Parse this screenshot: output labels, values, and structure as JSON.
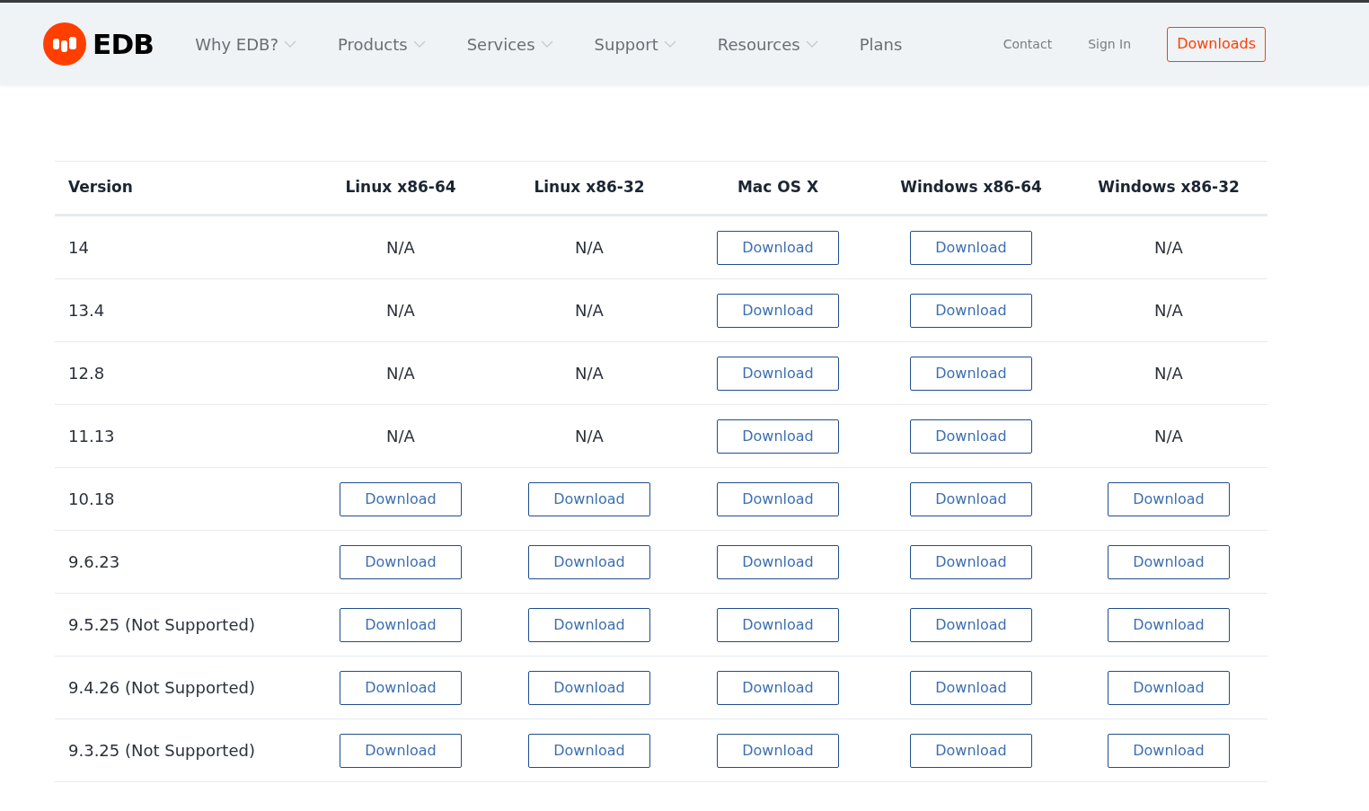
{
  "nav": {
    "brand": "EDB",
    "menu": [
      {
        "label": "Why EDB?",
        "dropdown": true
      },
      {
        "label": "Products",
        "dropdown": true
      },
      {
        "label": "Services",
        "dropdown": true
      },
      {
        "label": "Support",
        "dropdown": true
      },
      {
        "label": "Resources",
        "dropdown": true
      },
      {
        "label": "Plans",
        "dropdown": false
      }
    ],
    "links": [
      "Contact",
      "Sign In"
    ],
    "cta": "Downloads"
  },
  "table": {
    "columns": [
      "Version",
      "Linux x86-64",
      "Linux x86-32",
      "Mac OS X",
      "Windows x86-64",
      "Windows x86-32"
    ],
    "rows": [
      {
        "cells": [
          {
            "kind": "version",
            "text": "14"
          },
          {
            "kind": "text",
            "text": "N/A"
          },
          {
            "kind": "text",
            "text": "N/A"
          },
          {
            "kind": "button",
            "text": "Download"
          },
          {
            "kind": "button",
            "text": "Download"
          },
          {
            "kind": "text",
            "text": "N/A"
          }
        ]
      },
      {
        "cells": [
          {
            "kind": "version",
            "text": "13.4"
          },
          {
            "kind": "text",
            "text": "N/A"
          },
          {
            "kind": "text",
            "text": "N/A"
          },
          {
            "kind": "button",
            "text": "Download"
          },
          {
            "kind": "button",
            "text": "Download"
          },
          {
            "kind": "text",
            "text": "N/A"
          }
        ]
      },
      {
        "cells": [
          {
            "kind": "version",
            "text": "12.8"
          },
          {
            "kind": "text",
            "text": "N/A"
          },
          {
            "kind": "text",
            "text": "N/A"
          },
          {
            "kind": "button",
            "text": "Download"
          },
          {
            "kind": "button",
            "text": "Download"
          },
          {
            "kind": "text",
            "text": "N/A"
          }
        ]
      },
      {
        "cells": [
          {
            "kind": "version",
            "text": "11.13"
          },
          {
            "kind": "text",
            "text": "N/A"
          },
          {
            "kind": "text",
            "text": "N/A"
          },
          {
            "kind": "button",
            "text": "Download"
          },
          {
            "kind": "button",
            "text": "Download"
          },
          {
            "kind": "text",
            "text": "N/A"
          }
        ]
      },
      {
        "cells": [
          {
            "kind": "version",
            "text": "10.18"
          },
          {
            "kind": "button",
            "text": "Download"
          },
          {
            "kind": "button",
            "text": "Download"
          },
          {
            "kind": "button",
            "text": "Download"
          },
          {
            "kind": "button",
            "text": "Download"
          },
          {
            "kind": "button",
            "text": "Download"
          }
        ]
      },
      {
        "cells": [
          {
            "kind": "version",
            "text": "9.6.23"
          },
          {
            "kind": "button",
            "text": "Download"
          },
          {
            "kind": "button",
            "text": "Download"
          },
          {
            "kind": "button",
            "text": "Download"
          },
          {
            "kind": "button",
            "text": "Download"
          },
          {
            "kind": "button",
            "text": "Download"
          }
        ]
      },
      {
        "cells": [
          {
            "kind": "version",
            "text": "9.5.25 (Not Supported)"
          },
          {
            "kind": "button",
            "text": "Download"
          },
          {
            "kind": "button",
            "text": "Download"
          },
          {
            "kind": "button",
            "text": "Download"
          },
          {
            "kind": "button",
            "text": "Download"
          },
          {
            "kind": "button",
            "text": "Download"
          }
        ]
      },
      {
        "cells": [
          {
            "kind": "version",
            "text": "9.4.26 (Not Supported)"
          },
          {
            "kind": "button",
            "text": "Download"
          },
          {
            "kind": "button",
            "text": "Download"
          },
          {
            "kind": "button",
            "text": "Download"
          },
          {
            "kind": "button",
            "text": "Download"
          },
          {
            "kind": "button",
            "text": "Download"
          }
        ]
      },
      {
        "cells": [
          {
            "kind": "version",
            "text": "9.3.25 (Not Supported)"
          },
          {
            "kind": "button",
            "text": "Download"
          },
          {
            "kind": "button",
            "text": "Download"
          },
          {
            "kind": "button",
            "text": "Download"
          },
          {
            "kind": "button",
            "text": "Download"
          },
          {
            "kind": "button",
            "text": "Download"
          }
        ]
      }
    ]
  }
}
